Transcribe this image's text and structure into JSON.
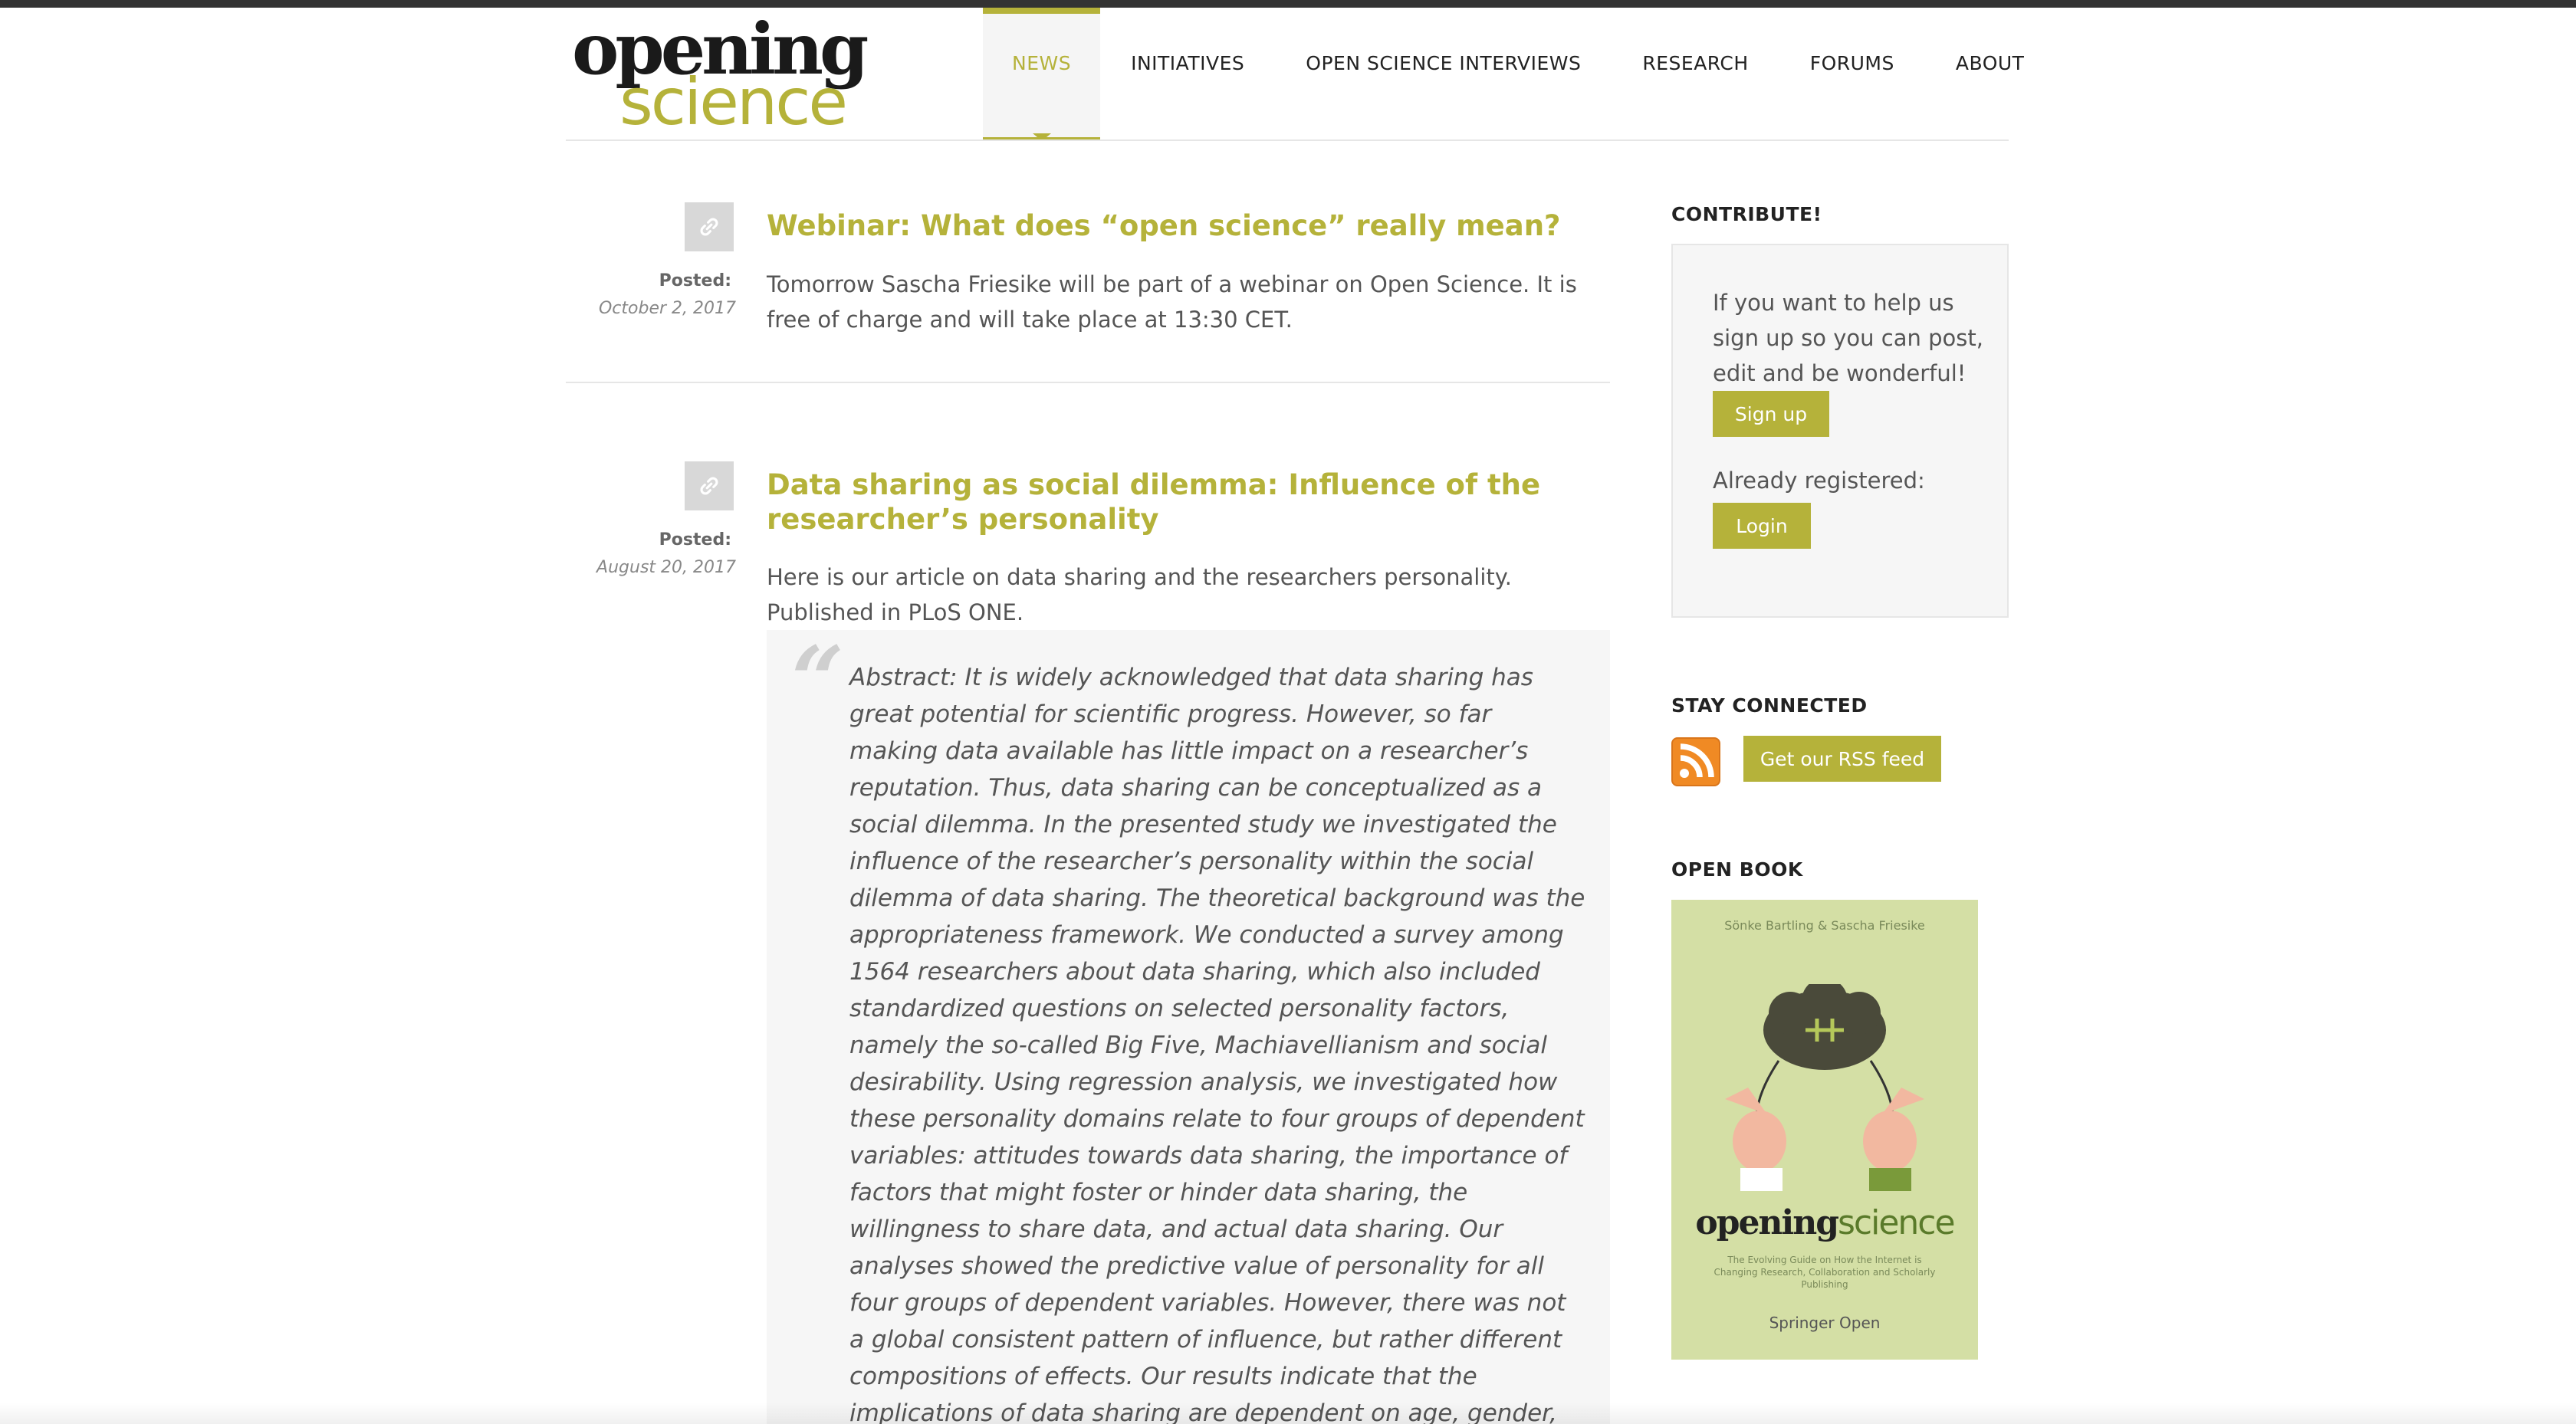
{
  "site": {
    "logo_line1": "opening",
    "logo_line2": "science"
  },
  "nav": {
    "items": [
      {
        "label": "NEWS",
        "active": true
      },
      {
        "label": "INITIATIVES",
        "active": false
      },
      {
        "label": "OPEN SCIENCE INTERVIEWS",
        "active": false
      },
      {
        "label": "RESEARCH",
        "active": false
      },
      {
        "label": "FORUMS",
        "active": false
      },
      {
        "label": "ABOUT",
        "active": false
      }
    ]
  },
  "posts": [
    {
      "icon": "link-icon",
      "posted_label": "Posted:",
      "date": "October 2, 2017",
      "title": "Webinar: What does “open science” really mean?",
      "body": "Tomorrow Sascha Friesike will be part of a webinar on Open Science. It is free of charge and will take place at 13:30 CET."
    },
    {
      "icon": "link-icon",
      "posted_label": "Posted:",
      "date": "August 20, 2017",
      "title": "Data sharing as social dilemma: Influence of the researcher’s personality",
      "body": "Here is our article on data sharing and the researchers personality. Published in PLoS ONE.",
      "quote": "Abstract: It is widely acknowledged that data sharing has great potential for scientific progress. However, so far making data available has little impact on a researcher’s reputation. Thus, data sharing can be conceptualized as a social dilemma. In the presented study we investigated the influence of the researcher’s personality within the social dilemma of data sharing. The theoretical background was the appropriateness framework. We conducted a survey among 1564 researchers about data sharing, which also included standardized questions on selected personality factors, namely the so-called Big Five, Machiavellianism and social desirability. Using regression analysis, we investigated how these personality domains relate to four groups of dependent variables: attitudes towards data sharing, the importance of factors that might foster or hinder data sharing, the willingness to share data, and actual data sharing. Our analyses showed the predictive value of personality for all four groups of dependent variables. However, there was not a global consistent pattern of influence, but rather different compositions of effects. Our results indicate that the implications of data sharing are dependent on age, gender, and personality. In order to foster data sharing, it seems"
    }
  ],
  "sidebar": {
    "contribute": {
      "heading": "CONTRIBUTE!",
      "text": "If you want to help us sign up so you can post, edit and be wonderful!",
      "signup_label": "Sign up",
      "registered_text": "Already registered:",
      "login_label": "Login"
    },
    "stay_connected": {
      "heading": "STAY CONNECTED",
      "rss_icon": "rss-icon",
      "rss_label": "Get our RSS feed"
    },
    "open_book": {
      "heading": "OPEN BOOK",
      "authors": "Sönke Bartling & Sascha Friesike",
      "title_part1": "opening",
      "title_part2": "science",
      "subtitle": "The Evolving Guide on How the Internet is Changing Research, Collaboration and Scholarly Publishing",
      "publisher": "Springer Open"
    }
  },
  "colors": {
    "accent": "#b5b23a",
    "text": "#555555",
    "topbar": "#333333",
    "rss": "#f08a24"
  }
}
